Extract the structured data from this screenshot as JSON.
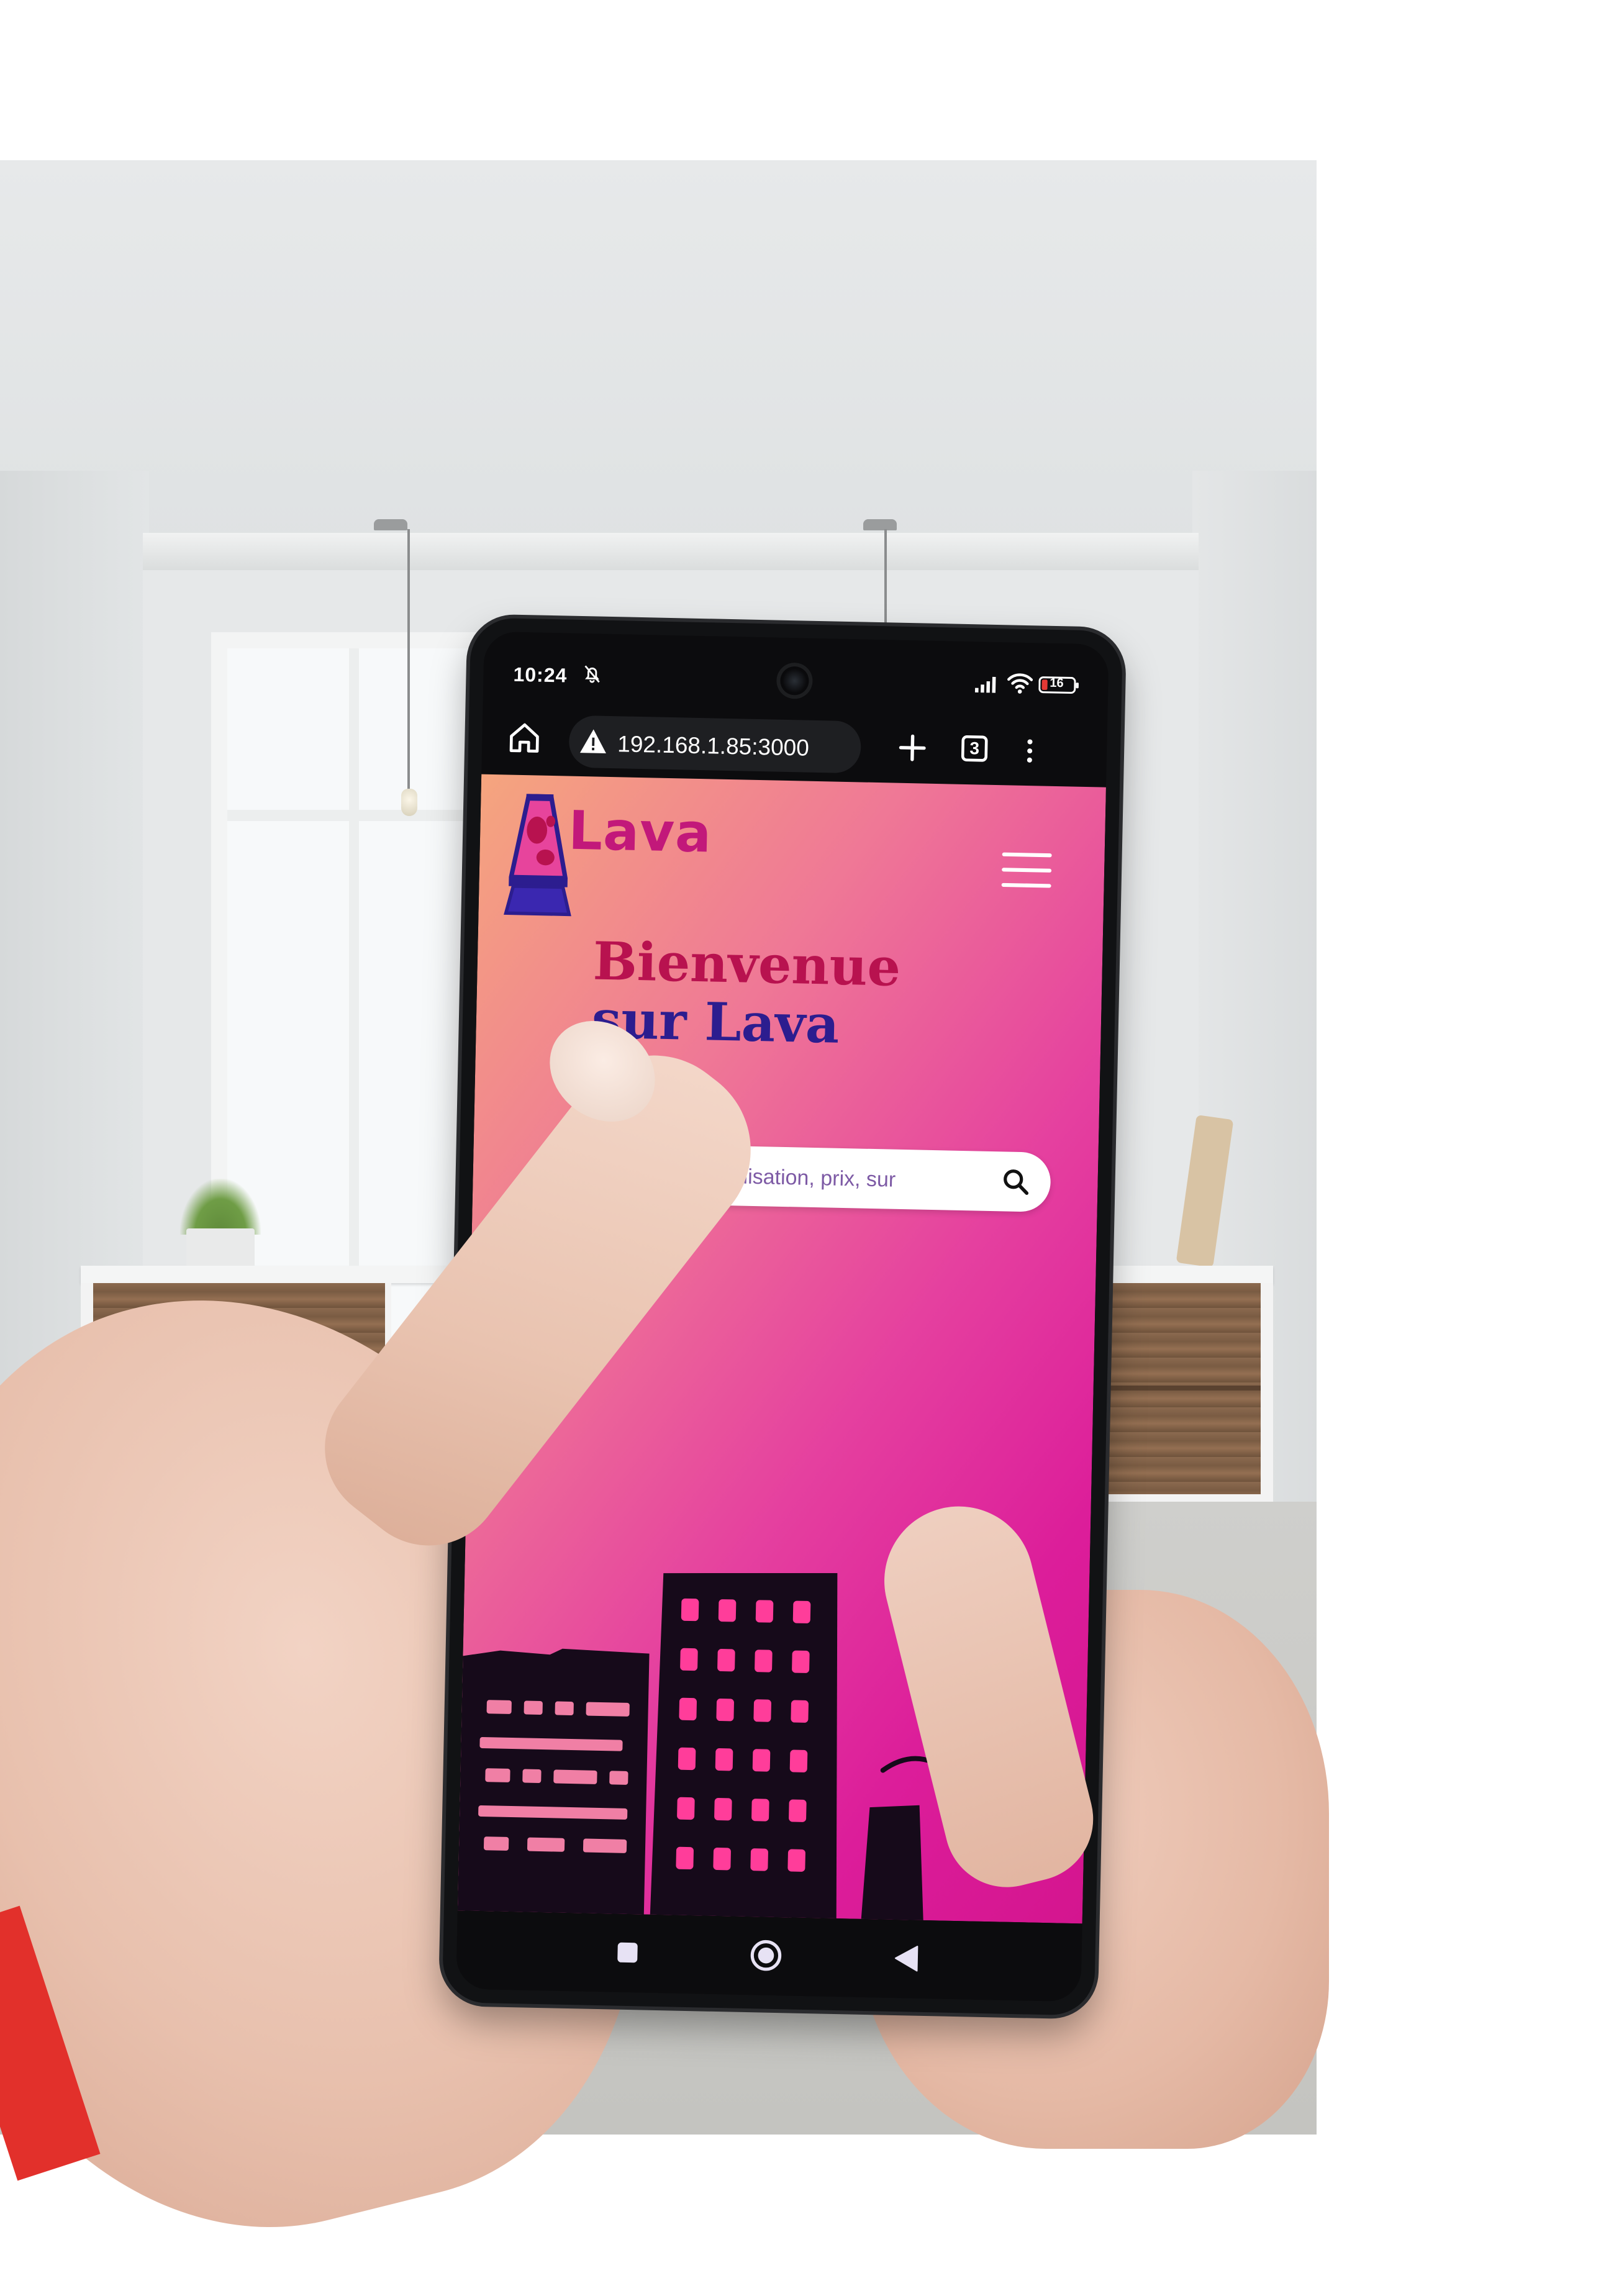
{
  "status_bar": {
    "time": "10:24",
    "battery_level": "16"
  },
  "browser": {
    "url": "192.168.1.85:3000",
    "tab_count": "3",
    "icons": [
      "home-icon",
      "warning-icon",
      "plus-icon",
      "tabs-icon",
      "menu-dots-icon"
    ]
  },
  "site": {
    "logo_text": "Lava",
    "hero_title_line1": "Bienvenue",
    "hero_title_line2": "sur Lava",
    "search_value": "la S.C.I., géolocalisation, prix, sur",
    "colors": {
      "gradient_start": "#f5a57e",
      "gradient_end": "#d4158f",
      "title_red": "#b8124f",
      "title_blue": "#2c1d8f",
      "logo_magenta": "#c2187a"
    }
  },
  "system_nav": {
    "icons": [
      "nav-recent-icon",
      "nav-home-icon",
      "nav-back-icon"
    ]
  }
}
